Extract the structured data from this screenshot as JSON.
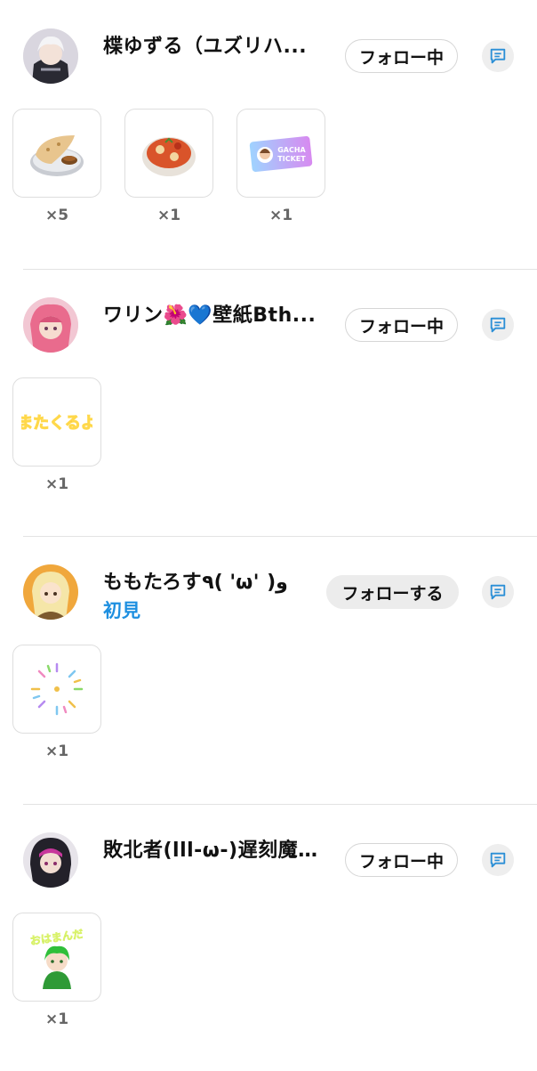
{
  "entries": [
    {
      "name": "楪ゆずる（ユズリハ...",
      "follow_label": "フォロー中",
      "gifts": [
        {
          "icon": "naan-curry-icon",
          "count": "×5"
        },
        {
          "icon": "tomato-curry-icon",
          "count": "×1"
        },
        {
          "icon": "gacha-ticket-icon",
          "count": "×1",
          "ticket_text": [
            "GACHA",
            "TICKET"
          ]
        }
      ]
    },
    {
      "name": "ワリン🌺💙壁紙Bth...",
      "follow_label": "フォロー中",
      "gifts": [
        {
          "icon": "matakuruyo-sticker-icon",
          "count": "×1",
          "sticker_text": "またくるよ"
        }
      ]
    },
    {
      "name": "ももたろす٩( 'ω' )و",
      "badge": "初見",
      "follow_label": "フォローする",
      "gifts": [
        {
          "icon": "fireworks-icon",
          "count": "×1"
        }
      ]
    },
    {
      "name": "敗北者(lll-ω-)遅刻魔...",
      "follow_label": "フォロー中",
      "gifts": [
        {
          "icon": "ohamanda-sticker-icon",
          "count": "×1",
          "sticker_text": "おはまんだ"
        }
      ]
    }
  ],
  "colors": {
    "badge": "#1d8fe0",
    "divider": "#e3e3e3",
    "button_bg": "#eeeeee"
  }
}
